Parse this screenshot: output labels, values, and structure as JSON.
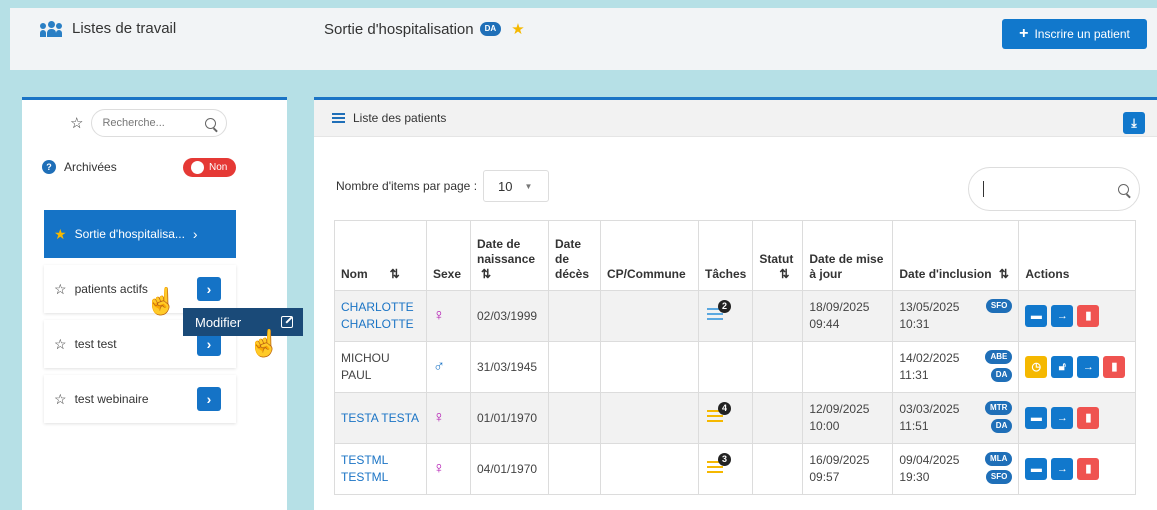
{
  "header": {
    "app_title": "Listes de travail",
    "page_title": "Sortie d'hospitalisation",
    "page_badge": "DA",
    "add_button": "Inscrire un patient"
  },
  "sidebar": {
    "search_placeholder": "Recherche...",
    "archived_label": "Archivées",
    "archived_toggle": "Non",
    "items": [
      {
        "label": "Sortie d'hospitalisa...",
        "active": true
      },
      {
        "label": "patients actifs"
      },
      {
        "label": "test test"
      },
      {
        "label": "test webinaire"
      }
    ],
    "tooltip": "Modifier"
  },
  "main": {
    "panel_title": "Liste des patients",
    "items_per_page_label": "Nombre d'items par page :",
    "items_per_page_value": "10",
    "table": {
      "headers": [
        "Nom",
        "Sexe",
        "Date de naissance",
        "Date de décès",
        "CP/Commune",
        "Tâches",
        "Statut",
        "Date de mise à jour",
        "Date d'inclusion",
        "Actions"
      ],
      "rows": [
        {
          "name": "CHARLOTTE CHARLOTTE",
          "sex": "♀",
          "dob": "02/03/1999",
          "dod": "",
          "cp": "",
          "tasks": "2",
          "status": "",
          "updated": "18/09/2025 09:44",
          "incl": "13/05/2025 10:31",
          "tags": [
            "SFO"
          ]
        },
        {
          "name": "MICHOU PAUL",
          "sex": "♂",
          "dob": "31/03/1945",
          "dod": "",
          "cp": "",
          "tasks": "",
          "status": "",
          "updated": "",
          "incl": "14/02/2025 11:31",
          "tags": [
            "ABE",
            "DA"
          ]
        },
        {
          "name": "TESTA TESTA",
          "sex": "♀",
          "dob": "01/01/1970",
          "dod": "",
          "cp": "",
          "tasks": "4",
          "status": "",
          "updated": "12/09/2025 10:00",
          "incl": "03/03/2025 11:51",
          "tags": [
            "MTR",
            "DA"
          ]
        },
        {
          "name": "TESTML TESTML",
          "sex": "♀",
          "dob": "04/01/1970",
          "dod": "",
          "cp": "",
          "tasks": "3",
          "status": "",
          "updated": "16/09/2025 09:57",
          "incl": "09/04/2025 19:30",
          "tags": [
            "MLA",
            "SFO"
          ]
        }
      ]
    }
  },
  "colors": {
    "primary": "#1178cc",
    "star": "#f5b800",
    "danger": "#ef5350",
    "female": "#b31bb3"
  }
}
